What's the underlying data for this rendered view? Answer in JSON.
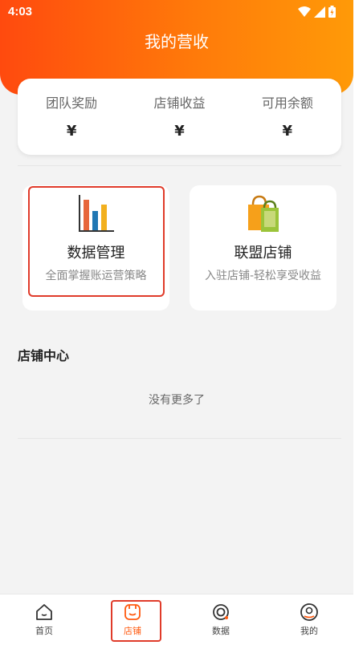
{
  "status": {
    "time": "4:03"
  },
  "header": {
    "title": "我的营收"
  },
  "summary": [
    {
      "label": "团队奖励",
      "value": "¥"
    },
    {
      "label": "店铺收益",
      "value": "¥"
    },
    {
      "label": "可用余额",
      "value": "¥"
    }
  ],
  "features": [
    {
      "title": "数据管理",
      "subtitle": "全面掌握账运营策略"
    },
    {
      "title": "联盟店铺",
      "subtitle": "入驻店铺-轻松享受收益"
    }
  ],
  "store_center": {
    "title": "店铺中心",
    "empty_text": "没有更多了"
  },
  "tabs": [
    {
      "label": "首页",
      "icon": "home-icon"
    },
    {
      "label": "店铺",
      "icon": "shop-icon",
      "active": true
    },
    {
      "label": "数据",
      "icon": "data-icon"
    },
    {
      "label": "我的",
      "icon": "profile-icon"
    }
  ],
  "colors": {
    "accent": "#ff5a10",
    "highlight": "#e03b2a"
  }
}
